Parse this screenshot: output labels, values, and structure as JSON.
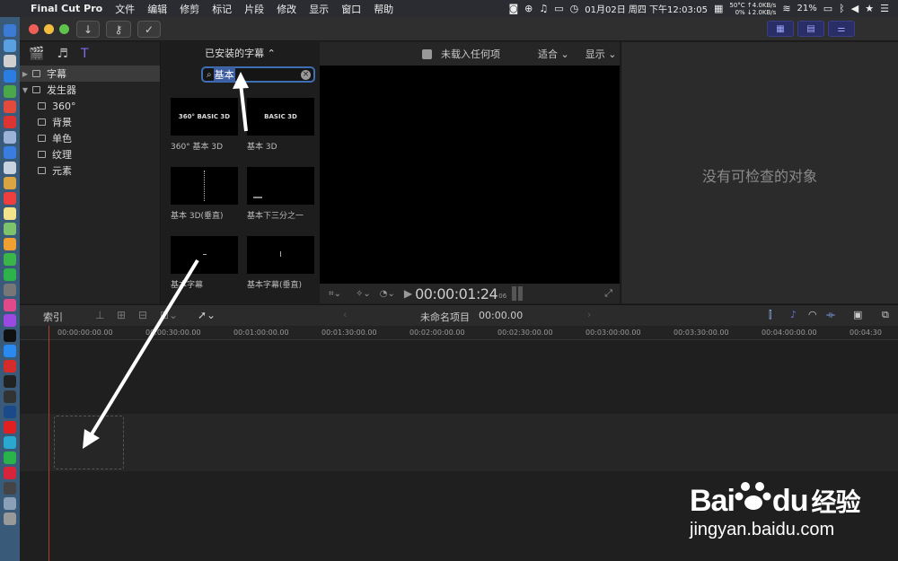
{
  "menubar": {
    "app_name": "Final Cut Pro",
    "items": [
      "文件",
      "编辑",
      "修剪",
      "标记",
      "片段",
      "修改",
      "显示",
      "窗口",
      "帮助"
    ],
    "temp": "50°C",
    "net_up": "↑4.0KB/s",
    "net_cpu": "0%",
    "net_down": "↓2.0KB/s",
    "datetime": "01月02日 周四 下午12:03:05",
    "battery": "21%"
  },
  "sidebar": {
    "items": [
      {
        "label": "字幕",
        "level": 0,
        "expanded": false,
        "selected": true
      },
      {
        "label": "发生器",
        "level": 0,
        "expanded": true,
        "selected": false
      },
      {
        "label": "360°",
        "level": 1
      },
      {
        "label": "背景",
        "level": 1
      },
      {
        "label": "单色",
        "level": 1
      },
      {
        "label": "纹理",
        "level": 1
      },
      {
        "label": "元素",
        "level": 1
      }
    ]
  },
  "browser": {
    "header": "已安装的字幕 ⌃",
    "search_value": "基本",
    "thumbs": [
      {
        "thumb_text": "360° BASIC 3D",
        "caption": "360° 基本 3D"
      },
      {
        "thumb_text": "BASIC 3D",
        "caption": "基本 3D"
      },
      {
        "thumb_text": "",
        "caption": "基本 3D(垂直)"
      },
      {
        "thumb_text": "",
        "caption": "基本下三分之一"
      },
      {
        "thumb_text": "",
        "caption": "基本字幕"
      },
      {
        "thumb_text": "",
        "caption": "基本字幕(垂直)"
      }
    ]
  },
  "viewer": {
    "status": "未载入任何项",
    "fit_label": "适合 ⌄",
    "view_label": "显示 ⌄",
    "timecode": "00:00:01:24",
    "timecode_frames": "06"
  },
  "inspector": {
    "empty_text": "没有可检查的对象"
  },
  "timeline": {
    "index_label": "索引",
    "project_name": "未命名项目",
    "project_time": "00:00.00",
    "ruler": [
      "00:00:00:00.00",
      "00:00:30:00.00",
      "00:01:00:00.00",
      "00:01:30:00.00",
      "00:02:00:00.00",
      "00:02:30:00.00",
      "00:03:00:00.00",
      "00:03:30:00.00",
      "00:04:00:00.00",
      "00:04:30"
    ]
  },
  "watermark": {
    "brand": "Bai",
    "brand_suffix": "du",
    "brand_cn": "经验",
    "url": "jingyan.baidu.com"
  },
  "colors": {
    "accent": "#3e6fb5",
    "playhead": "#a8412c",
    "active_button": "#2a2e66"
  }
}
